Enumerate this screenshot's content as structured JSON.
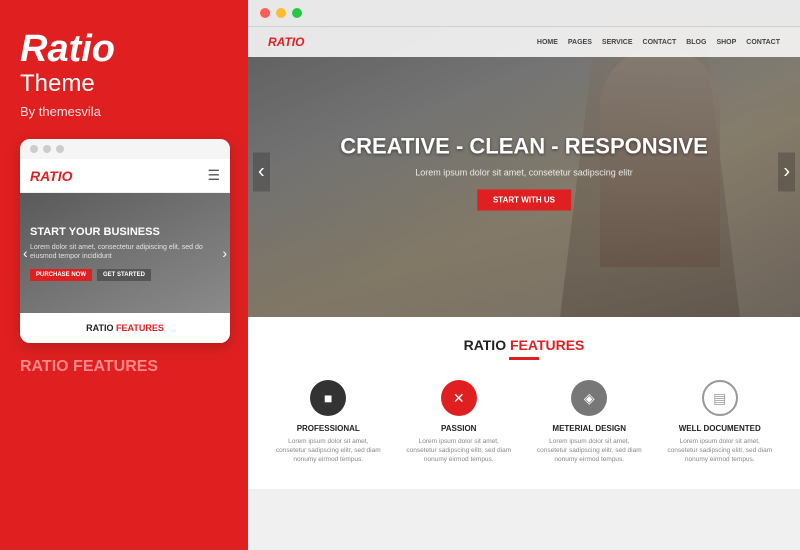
{
  "leftPanel": {
    "brandTitle": "Ratio",
    "brandSubtitle": "Theme",
    "brandBy": "By themesvila",
    "mobileMockup": {
      "dots": [
        "dot1",
        "dot2",
        "dot3"
      ],
      "logo": "RATIO",
      "heroTitle": "START YOUR BUSINESS",
      "heroText": "Lorem dolor sit amet, consectetur adipiscing elit, sed do eiusmod tempor incididunt",
      "btnPrimary": "PURCHASE NOW",
      "btnSecondary": "GET STARTED"
    },
    "bottomTitle": "RATIO",
    "bottomFeatures": "FEATURES"
  },
  "rightPanel": {
    "browser": {
      "dots": [
        "dot1",
        "dot2",
        "dot3"
      ]
    },
    "nav": {
      "logo": "RATIO",
      "links": [
        "HOME",
        "PAGES",
        "SERVICE",
        "CONTACT",
        "BLOG",
        "SHOP",
        "CONTACT"
      ]
    },
    "hero": {
      "mainTitle": "CREATIVE - CLEAN - RESPONSIVE",
      "subText": "Lorem ipsum dolor sit amet, consetetur sadipscing elitr",
      "ctaButton": "START WITH US",
      "arrowLeft": "‹",
      "arrowRight": "›"
    },
    "features": {
      "title": "RATIO",
      "titleHighlight": "FEATURES",
      "items": [
        {
          "iconSymbol": "■",
          "iconClass": "feature-icon-dark",
          "name": "PROFESSIONAL",
          "desc": "Lorem ipsum dolor sit amet, consetetur sadipscing elitr, sed diam nonumy eirmod tempus."
        },
        {
          "iconSymbol": "✕",
          "iconClass": "feature-icon-red",
          "name": "PASSION",
          "desc": "Lorem ipsum dolor sit amet, consetetur sadipscing elitr, sed diam nonumy eirmod tempus."
        },
        {
          "iconSymbol": "◈",
          "iconClass": "feature-icon-gray",
          "name": "METERIAL DESIGN",
          "desc": "Lorem ipsum dolor sit amet, consetetur sadipscing elitr, sed diam nonumy eirmod tempus."
        },
        {
          "iconSymbol": "▤",
          "iconClass": "feature-icon-outline",
          "name": "WELL DOCUMENTED",
          "desc": "Lorem ipsum dolor sit amet, consetetur sadipscing elitr, sed diam nonumy eirmod tempus."
        }
      ]
    }
  }
}
